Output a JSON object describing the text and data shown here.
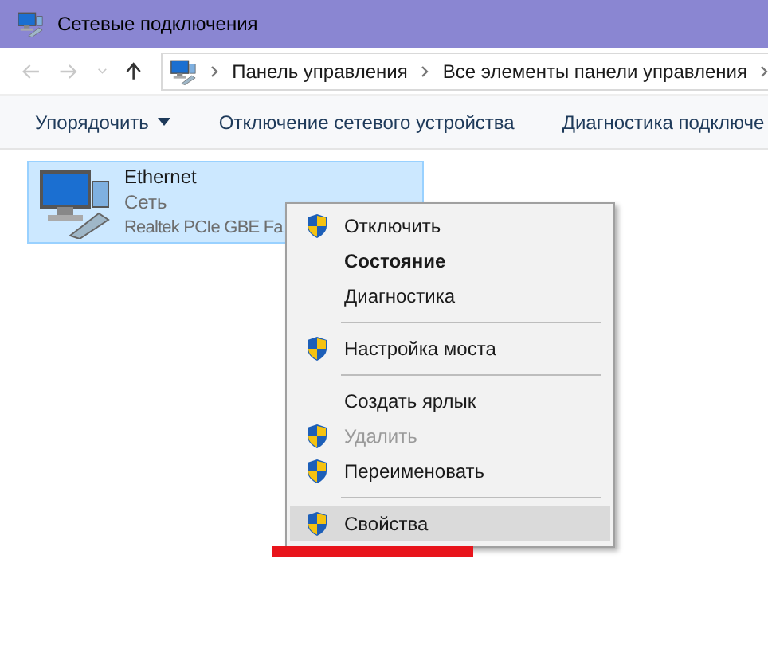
{
  "window": {
    "title": "Сетевые подключения"
  },
  "address_bar": {
    "breadcrumbs": [
      "Панель управления",
      "Все элементы панели управления"
    ]
  },
  "toolbar": {
    "buttons": [
      "Упорядочить",
      "Отключение сетевого устройства",
      "Диагностика подключе"
    ]
  },
  "connection": {
    "name": "Ethernet",
    "network": "Сеть",
    "adapter": "Realtek PCIe GBE Fa",
    "selected": true
  },
  "context_menu": {
    "items": [
      {
        "kind": "item",
        "label": "Отключить",
        "shield": true,
        "bold": false,
        "disabled": false,
        "selected": false
      },
      {
        "kind": "item",
        "label": "Состояние",
        "shield": false,
        "bold": true,
        "disabled": false,
        "selected": false
      },
      {
        "kind": "item",
        "label": "Диагностика",
        "shield": false,
        "bold": false,
        "disabled": false,
        "selected": false
      },
      {
        "kind": "separator"
      },
      {
        "kind": "item",
        "label": "Настройка моста",
        "shield": true,
        "bold": false,
        "disabled": false,
        "selected": false
      },
      {
        "kind": "separator"
      },
      {
        "kind": "item",
        "label": "Создать ярлык",
        "shield": false,
        "bold": false,
        "disabled": false,
        "selected": false
      },
      {
        "kind": "item",
        "label": "Удалить",
        "shield": true,
        "bold": false,
        "disabled": true,
        "selected": false
      },
      {
        "kind": "item",
        "label": "Переименовать",
        "shield": true,
        "bold": false,
        "disabled": false,
        "selected": false
      },
      {
        "kind": "separator"
      },
      {
        "kind": "item",
        "label": "Свойства",
        "shield": true,
        "bold": false,
        "disabled": false,
        "selected": true
      }
    ]
  }
}
